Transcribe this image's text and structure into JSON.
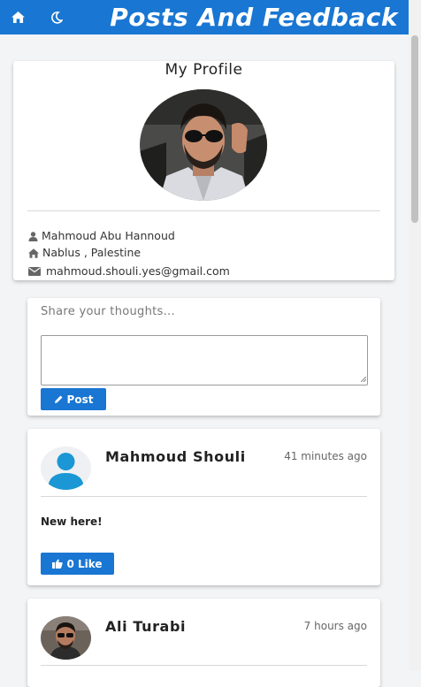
{
  "header": {
    "title": "Posts And Feedback",
    "home_icon": "home-icon",
    "theme_icon": "moon-icon",
    "color": "#1976d2"
  },
  "profile": {
    "heading": "My Profile",
    "name": "Mahmoud Abu Hannoud",
    "location": "Nablus , Palestine",
    "email": "mahmoud.shouli.yes@gmail.com",
    "icons": [
      "user-icon",
      "home-icon",
      "envelope-icon"
    ]
  },
  "composer": {
    "prompt": "Share your thoughts...",
    "value": "",
    "post_label": "Post",
    "post_icon": "pencil-icon"
  },
  "posts": [
    {
      "author": "Mahmoud Shouli",
      "time": "41 minutes ago",
      "body": "New here!",
      "like_label": "0 Like",
      "like_icon": "thumbs-up-icon",
      "avatar": "default-user-avatar"
    },
    {
      "author": "Ali Turabi",
      "time": "7 hours ago",
      "avatar": "user-photo-avatar"
    }
  ]
}
